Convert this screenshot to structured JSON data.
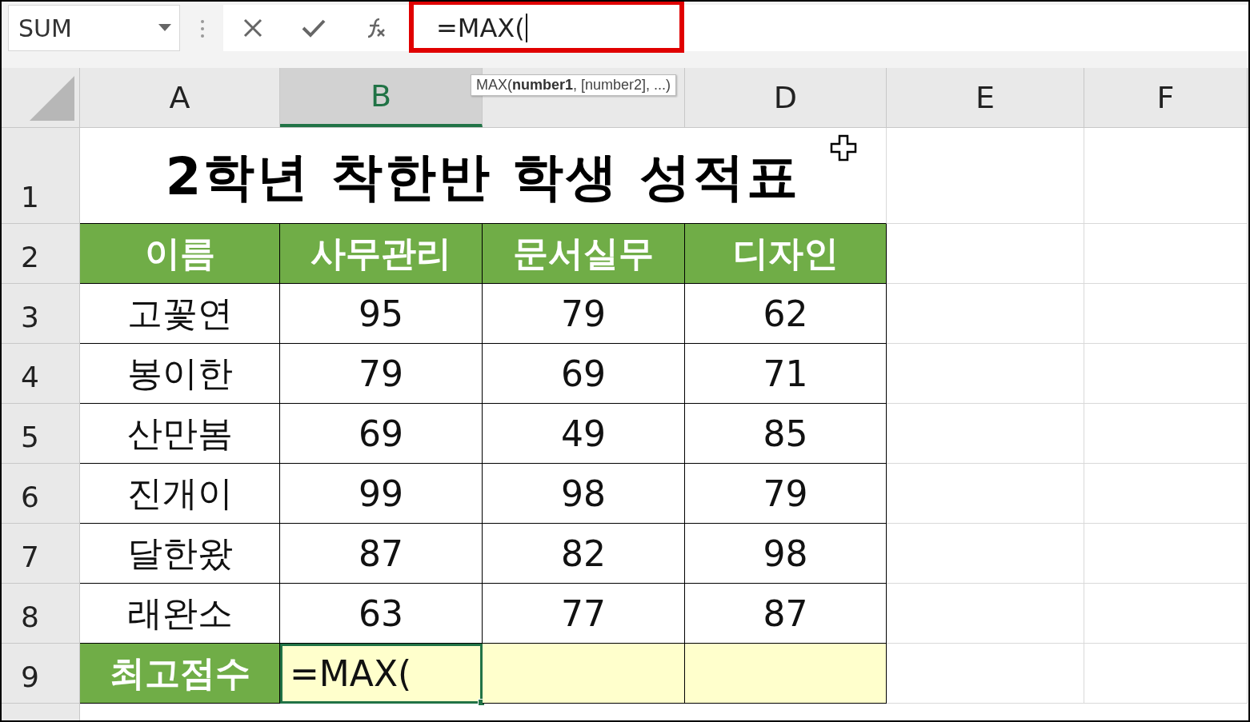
{
  "formula_bar": {
    "name_box": "SUM",
    "formula": "=MAX(",
    "highlighted": true
  },
  "tooltip": "MAX(**number1**, [number2], ...)",
  "columns": [
    {
      "label": "A",
      "selected": false
    },
    {
      "label": "B",
      "selected": true
    },
    {
      "selected": false
    },
    {
      "label": "D",
      "selected": false
    },
    {
      "label": "E",
      "selected": false
    },
    {
      "label": "F",
      "selected": false
    }
  ],
  "rows": [
    {
      "label": "1",
      "kind": "title",
      "cells": [
        "2학년 착한반 학생 성적표"
      ]
    },
    {
      "label": "2",
      "kind": "header",
      "cells": [
        "이름",
        "사무관리",
        "문서실무",
        "디자인"
      ]
    },
    {
      "label": "3",
      "kind": "data",
      "cells": [
        "고꽃연",
        "95",
        "79",
        "62"
      ]
    },
    {
      "label": "4",
      "kind": "data",
      "cells": [
        "봉이한",
        "79",
        "69",
        "71"
      ]
    },
    {
      "label": "5",
      "kind": "data",
      "cells": [
        "산만봄",
        "69",
        "49",
        "85"
      ]
    },
    {
      "label": "6",
      "kind": "data",
      "cells": [
        "진개이",
        "99",
        "98",
        "79"
      ]
    },
    {
      "label": "7",
      "kind": "data",
      "cells": [
        "달한왔",
        "87",
        "82",
        "98"
      ]
    },
    {
      "label": "8",
      "kind": "data",
      "cells": [
        "래완소",
        "63",
        "77",
        "87"
      ]
    },
    {
      "label": "9",
      "kind": "total",
      "cells": [
        "최고점수",
        "=MAX("
      ],
      "selected": [
        false,
        true
      ]
    }
  ]
}
